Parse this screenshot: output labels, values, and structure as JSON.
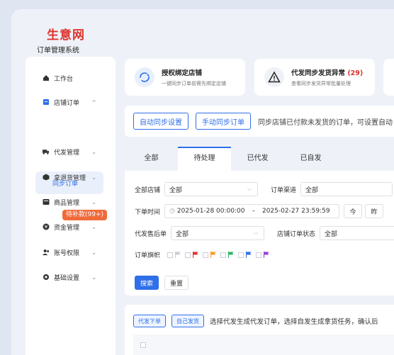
{
  "logo": {
    "main": "生意网",
    "sub": "订单管理系统"
  },
  "sidebar": {
    "items": [
      {
        "label": "工作台",
        "icon": "home-icon",
        "chevron": ""
      },
      {
        "label": "店铺订单",
        "icon": "shop-icon",
        "chevron": "^"
      },
      {
        "label": "同步订单",
        "icon": "",
        "chevron": ""
      },
      {
        "label": "代发管理",
        "icon": "truck-icon",
        "chevron": "⌄"
      },
      {
        "label": "拿退货管理",
        "icon": "box-icon",
        "chevron": "⌄"
      },
      {
        "label": "商品管理",
        "icon": "goods-icon",
        "chevron": "⌄"
      },
      {
        "label": "资金管理",
        "icon": "money-icon",
        "chevron": "⌄"
      },
      {
        "label": "账号权限",
        "icon": "user-icon",
        "chevron": "⌄"
      },
      {
        "label": "基础设置",
        "icon": "gear-icon",
        "chevron": "⌄"
      }
    ],
    "floating_badge": "待补款(99+)"
  },
  "cards": [
    {
      "title": "授权绑定店铺",
      "sub": "一键同步订单前需先绑定店铺",
      "icon": "sync-icon"
    },
    {
      "title": "代发同步发货异常",
      "count": "(29)",
      "sub": "查看同步发货异常批量处理",
      "icon": "warning-icon"
    }
  ],
  "syncbar": {
    "btn_auto": "自动同步设置",
    "btn_manual": "手动同步订单",
    "text": "同步店铺已付款未发货的订单，可设置自动"
  },
  "tabs": [
    "全部",
    "待处理",
    "已代发",
    "已自发"
  ],
  "filters": {
    "shop_label": "全部店铺",
    "shop_value": "全部",
    "channel_label": "订单渠道",
    "channel_value": "全部",
    "time_label": "下单时间",
    "time_start": "2025-01-28 00:00:00",
    "time_sep": "–",
    "time_end": "2025-02-27 23:59:59",
    "today": "今",
    "yesterday": "昨",
    "after_sale_label": "代发售后单",
    "after_sale_value": "全部",
    "shop_status_label": "店铺订单状态",
    "shop_status_value": "全部",
    "flag_label": "订单旗帜",
    "search": "搜索",
    "reset": "重置"
  },
  "bottom": {
    "btn_proxy": "代发下单",
    "btn_self": "自己发货",
    "text": "选择代发生成代发订单，选择自发生成拿货任务，确认后"
  },
  "colors": {
    "accent": "#2f6fe8",
    "danger": "#e0322c",
    "flags": [
      "#c8ccd4",
      "#e0322c",
      "#f59a23",
      "#2bb45c",
      "#2f6fe8",
      "#9b3fd6"
    ]
  }
}
